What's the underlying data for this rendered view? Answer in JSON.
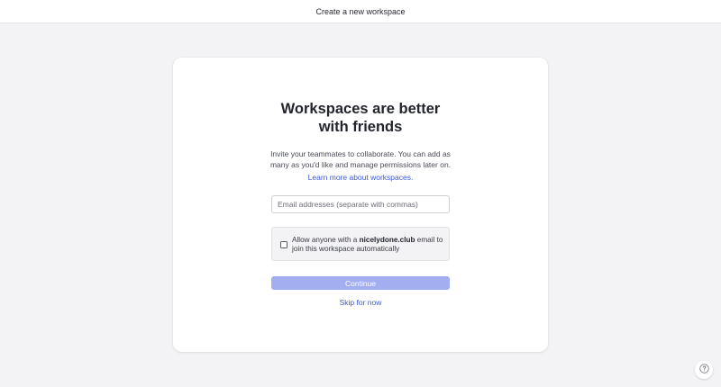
{
  "header": {
    "title": "Create a new workspace"
  },
  "card": {
    "headline_line1": "Workspaces are better",
    "headline_line2": "with friends",
    "subtitle": "Invite your teammates to collaborate. You can add as many as you'd like and manage permissions later on.",
    "learn_more_label": "Learn more about workspaces.",
    "email_input": {
      "value": "",
      "placeholder": "Email addresses (separate with commas)"
    },
    "allow_option": {
      "checked": false,
      "text_before": "Allow anyone with a ",
      "domain": "nicelydone.club",
      "text_after": " email to join this workspace automatically"
    },
    "continue_label": "Continue",
    "skip_label": "Skip for now"
  },
  "help": {
    "icon": "question-circle-icon"
  },
  "colors": {
    "accent": "#3b5bd9",
    "button_disabled": "#a3aef0",
    "background": "#f3f3f5"
  }
}
